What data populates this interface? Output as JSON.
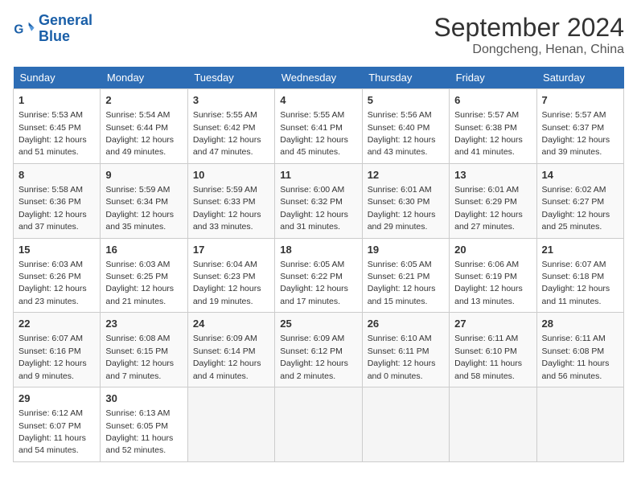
{
  "logo": {
    "line1": "General",
    "line2": "Blue"
  },
  "title": {
    "month_year": "September 2024",
    "location": "Dongcheng, Henan, China"
  },
  "days_of_week": [
    "Sunday",
    "Monday",
    "Tuesday",
    "Wednesday",
    "Thursday",
    "Friday",
    "Saturday"
  ],
  "weeks": [
    [
      {
        "num": "1",
        "sunrise": "5:53 AM",
        "sunset": "6:45 PM",
        "daylight": "12 hours and 51 minutes."
      },
      {
        "num": "2",
        "sunrise": "5:54 AM",
        "sunset": "6:44 PM",
        "daylight": "12 hours and 49 minutes."
      },
      {
        "num": "3",
        "sunrise": "5:55 AM",
        "sunset": "6:42 PM",
        "daylight": "12 hours and 47 minutes."
      },
      {
        "num": "4",
        "sunrise": "5:55 AM",
        "sunset": "6:41 PM",
        "daylight": "12 hours and 45 minutes."
      },
      {
        "num": "5",
        "sunrise": "5:56 AM",
        "sunset": "6:40 PM",
        "daylight": "12 hours and 43 minutes."
      },
      {
        "num": "6",
        "sunrise": "5:57 AM",
        "sunset": "6:38 PM",
        "daylight": "12 hours and 41 minutes."
      },
      {
        "num": "7",
        "sunrise": "5:57 AM",
        "sunset": "6:37 PM",
        "daylight": "12 hours and 39 minutes."
      }
    ],
    [
      {
        "num": "8",
        "sunrise": "5:58 AM",
        "sunset": "6:36 PM",
        "daylight": "12 hours and 37 minutes."
      },
      {
        "num": "9",
        "sunrise": "5:59 AM",
        "sunset": "6:34 PM",
        "daylight": "12 hours and 35 minutes."
      },
      {
        "num": "10",
        "sunrise": "5:59 AM",
        "sunset": "6:33 PM",
        "daylight": "12 hours and 33 minutes."
      },
      {
        "num": "11",
        "sunrise": "6:00 AM",
        "sunset": "6:32 PM",
        "daylight": "12 hours and 31 minutes."
      },
      {
        "num": "12",
        "sunrise": "6:01 AM",
        "sunset": "6:30 PM",
        "daylight": "12 hours and 29 minutes."
      },
      {
        "num": "13",
        "sunrise": "6:01 AM",
        "sunset": "6:29 PM",
        "daylight": "12 hours and 27 minutes."
      },
      {
        "num": "14",
        "sunrise": "6:02 AM",
        "sunset": "6:27 PM",
        "daylight": "12 hours and 25 minutes."
      }
    ],
    [
      {
        "num": "15",
        "sunrise": "6:03 AM",
        "sunset": "6:26 PM",
        "daylight": "12 hours and 23 minutes."
      },
      {
        "num": "16",
        "sunrise": "6:03 AM",
        "sunset": "6:25 PM",
        "daylight": "12 hours and 21 minutes."
      },
      {
        "num": "17",
        "sunrise": "6:04 AM",
        "sunset": "6:23 PM",
        "daylight": "12 hours and 19 minutes."
      },
      {
        "num": "18",
        "sunrise": "6:05 AM",
        "sunset": "6:22 PM",
        "daylight": "12 hours and 17 minutes."
      },
      {
        "num": "19",
        "sunrise": "6:05 AM",
        "sunset": "6:21 PM",
        "daylight": "12 hours and 15 minutes."
      },
      {
        "num": "20",
        "sunrise": "6:06 AM",
        "sunset": "6:19 PM",
        "daylight": "12 hours and 13 minutes."
      },
      {
        "num": "21",
        "sunrise": "6:07 AM",
        "sunset": "6:18 PM",
        "daylight": "12 hours and 11 minutes."
      }
    ],
    [
      {
        "num": "22",
        "sunrise": "6:07 AM",
        "sunset": "6:16 PM",
        "daylight": "12 hours and 9 minutes."
      },
      {
        "num": "23",
        "sunrise": "6:08 AM",
        "sunset": "6:15 PM",
        "daylight": "12 hours and 7 minutes."
      },
      {
        "num": "24",
        "sunrise": "6:09 AM",
        "sunset": "6:14 PM",
        "daylight": "12 hours and 4 minutes."
      },
      {
        "num": "25",
        "sunrise": "6:09 AM",
        "sunset": "6:12 PM",
        "daylight": "12 hours and 2 minutes."
      },
      {
        "num": "26",
        "sunrise": "6:10 AM",
        "sunset": "6:11 PM",
        "daylight": "12 hours and 0 minutes."
      },
      {
        "num": "27",
        "sunrise": "6:11 AM",
        "sunset": "6:10 PM",
        "daylight": "11 hours and 58 minutes."
      },
      {
        "num": "28",
        "sunrise": "6:11 AM",
        "sunset": "6:08 PM",
        "daylight": "11 hours and 56 minutes."
      }
    ],
    [
      {
        "num": "29",
        "sunrise": "6:12 AM",
        "sunset": "6:07 PM",
        "daylight": "11 hours and 54 minutes."
      },
      {
        "num": "30",
        "sunrise": "6:13 AM",
        "sunset": "6:05 PM",
        "daylight": "11 hours and 52 minutes."
      },
      null,
      null,
      null,
      null,
      null
    ]
  ]
}
